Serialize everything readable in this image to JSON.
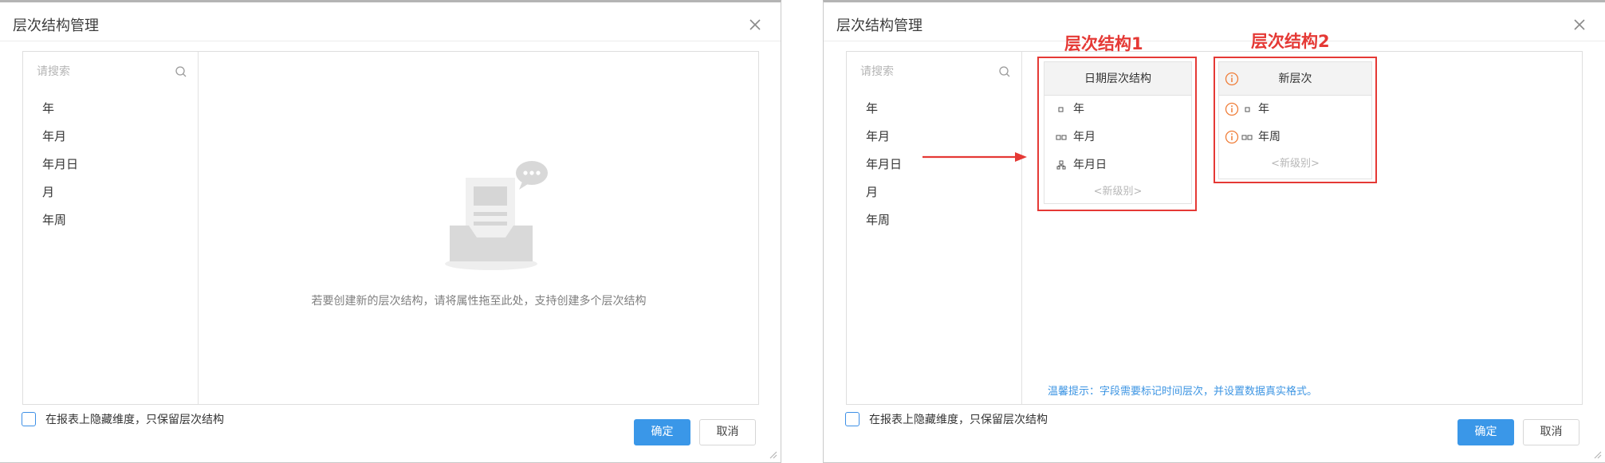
{
  "dialog_title": "层次结构管理",
  "search": {
    "placeholder": "请搜索"
  },
  "fields": [
    "年",
    "年月",
    "年月日",
    "月",
    "年周"
  ],
  "empty_state": {
    "message": "若要创建新的层次结构，请将属性拖至此处，支持创建多个层次结构"
  },
  "footer": {
    "hide_dimension_label": "在报表上隐藏维度，只保留层次结构",
    "ok_label": "确定",
    "cancel_label": "取消"
  },
  "hierarchies": [
    {
      "annotation": "层次结构1",
      "title": "日期层次结构",
      "levels": [
        "年",
        "年月",
        "年月日"
      ],
      "new_level_label": "<新级别>",
      "has_warning": false
    },
    {
      "annotation": "层次结构2",
      "title": "新层次",
      "levels": [
        "年",
        "年周"
      ],
      "new_level_label": "<新级别>",
      "has_warning": true
    }
  ],
  "hint": "温馨提示：字段需要标记时间层次，并设置数据真实格式。",
  "colors": {
    "primary": "#3a97e8",
    "annotation_red": "#e53935",
    "warning_orange": "#f07d38",
    "hint_blue": "#3d95e3"
  }
}
